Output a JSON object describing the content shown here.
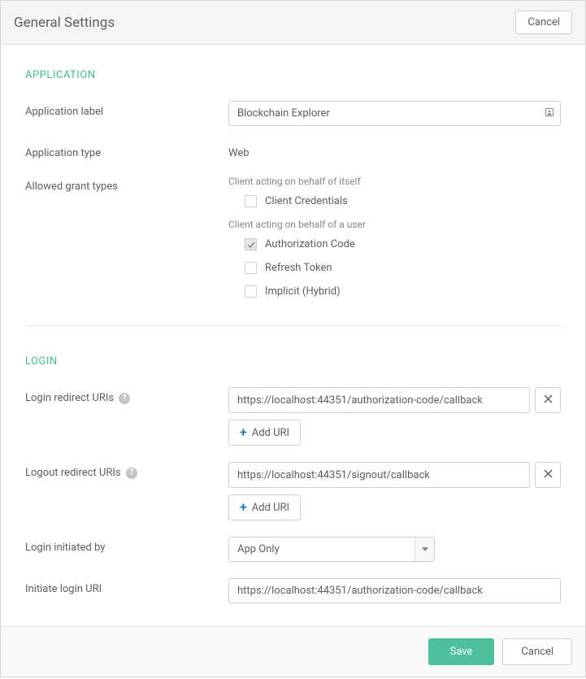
{
  "header": {
    "title": "General Settings",
    "cancel_label": "Cancel"
  },
  "application": {
    "section_title": "APPLICATION",
    "label_field": "Application label",
    "label_value": "Blockchain Explorer",
    "type_field": "Application type",
    "type_value": "Web",
    "grant_field": "Allowed grant types",
    "grant_self_heading": "Client acting on behalf of itself",
    "grant_user_heading": "Client acting on behalf of a user",
    "grant_options": {
      "client_credentials": {
        "label": "Client Credentials",
        "checked": false
      },
      "authorization_code": {
        "label": "Authorization Code",
        "checked": true
      },
      "refresh_token": {
        "label": "Refresh Token",
        "checked": false
      },
      "implicit": {
        "label": "Implicit (Hybrid)",
        "checked": false
      }
    }
  },
  "login": {
    "section_title": "LOGIN",
    "login_redirect_label": "Login redirect URIs",
    "login_redirect_uri": "https://localhost:44351/authorization-code/callback",
    "logout_redirect_label": "Logout redirect URIs",
    "logout_redirect_uri": "https://localhost:44351/signout/callback",
    "add_uri_label": "Add URI",
    "initiated_by_label": "Login initiated by",
    "initiated_by_value": "App Only",
    "initiate_uri_label": "Initiate login URI",
    "initiate_uri_value": "https://localhost:44351/authorization-code/callback"
  },
  "footer": {
    "save_label": "Save",
    "cancel_label": "Cancel"
  }
}
